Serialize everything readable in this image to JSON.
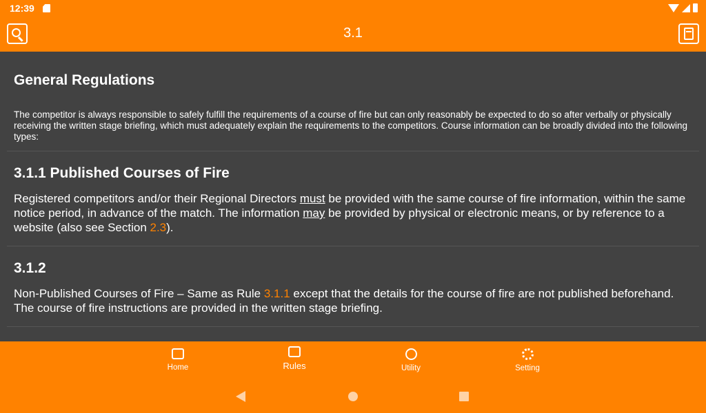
{
  "status_bar": {
    "time": "12:39"
  },
  "app_bar": {
    "title": "3.1"
  },
  "content": {
    "general": {
      "heading": "General Regulations",
      "body": "The competitor is always responsible to safely fulfill the requirements of a course of fire but can only reasonably be expected to do so after verbally or physically receiving the written stage briefing, which must adequately explain the requirements to the competitors. Course information can be broadly divided into the following types:"
    },
    "rule_311": {
      "heading": "3.1.1 Published Courses of Fire",
      "text_1": "Registered competitors and/or their Regional Directors ",
      "underline_1": "must",
      "text_2": " be provided with the same course of fire information, within the same notice period, in advance of the match. The information ",
      "underline_2": "may",
      "text_3": " be provided by physical or electronic means, or by reference to a website (also see Section ",
      "link": "2.3",
      "text_4": ")."
    },
    "rule_312": {
      "heading": "3.1.2",
      "text_1": "Non-Published Courses of Fire – Same as Rule ",
      "link": "3.1.1",
      "text_2": " except that the details for the course of fire are not published beforehand. The course of fire instructions are provided in the written stage briefing."
    }
  },
  "bottom_nav": {
    "items": [
      {
        "label": "Home",
        "icon": "home-icon"
      },
      {
        "label": "Rules",
        "icon": "rules-icon"
      },
      {
        "label": "Utility",
        "icon": "timer-icon"
      },
      {
        "label": "Setting",
        "icon": "gear-icon"
      }
    ]
  },
  "colors": {
    "accent": "#ff8200",
    "background": "#424242",
    "link": "#ff8200"
  }
}
